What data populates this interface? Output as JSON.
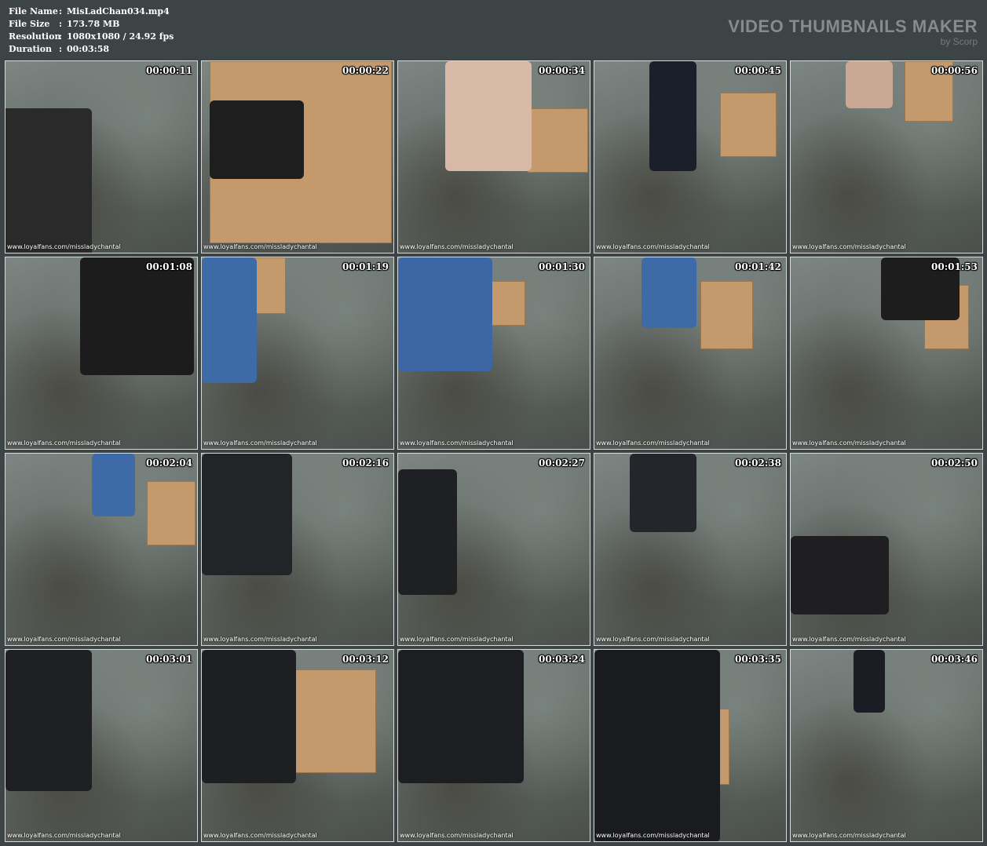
{
  "file_info": {
    "rows": [
      {
        "key": "File Name",
        "sep": ":",
        "value": "MisLadChan034.mp4"
      },
      {
        "key": "File Size",
        "sep": ":",
        "value": "173.78 MB"
      },
      {
        "key": "Resolution",
        "sep": ":",
        "value": "1080x1080 / 24.92 fps"
      },
      {
        "key": "Duration",
        "sep": ":",
        "value": "00:03:58"
      }
    ]
  },
  "brand": {
    "title": "VIDEO THUMBNAILS MAKER",
    "by": "by Scorp"
  },
  "watermark": "www.loyalfans.com/missladychantal",
  "thumbnails": [
    {
      "time": "00:00:11"
    },
    {
      "time": "00:00:22"
    },
    {
      "time": "00:00:34"
    },
    {
      "time": "00:00:45"
    },
    {
      "time": "00:00:56"
    },
    {
      "time": "00:01:08"
    },
    {
      "time": "00:01:19"
    },
    {
      "time": "00:01:30"
    },
    {
      "time": "00:01:42"
    },
    {
      "time": "00:01:53"
    },
    {
      "time": "00:02:04"
    },
    {
      "time": "00:02:16"
    },
    {
      "time": "00:02:27"
    },
    {
      "time": "00:02:38"
    },
    {
      "time": "00:02:50"
    },
    {
      "time": "00:03:01"
    },
    {
      "time": "00:03:12"
    },
    {
      "time": "00:03:24"
    },
    {
      "time": "00:03:35"
    },
    {
      "time": "00:03:46"
    }
  ]
}
